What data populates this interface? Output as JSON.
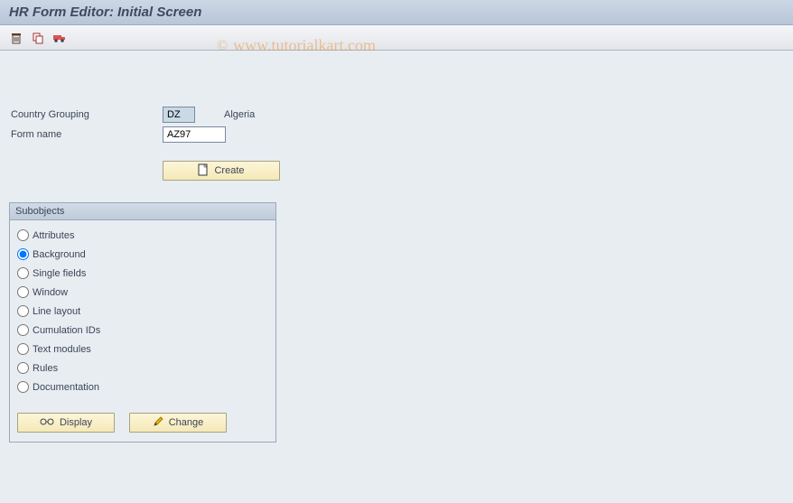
{
  "title": "HR Form Editor: Initial Screen",
  "watermark": "www.tutorialkart.com",
  "fields": {
    "country_grouping_label": "Country Grouping",
    "country_grouping_value": "DZ",
    "country_grouping_text": "Algeria",
    "form_name_label": "Form name",
    "form_name_value": "AZ97"
  },
  "buttons": {
    "create": "Create",
    "display": "Display",
    "change": "Change"
  },
  "groupbox": {
    "title": "Subobjects",
    "options": {
      "attributes": "Attributes",
      "background": "Background",
      "single_fields": "Single fields",
      "window": "Window",
      "line_layout": "Line layout",
      "cumulation_ids": "Cumulation IDs",
      "text_modules": "Text modules",
      "rules": "Rules",
      "documentation": "Documentation"
    },
    "selected": "background"
  }
}
